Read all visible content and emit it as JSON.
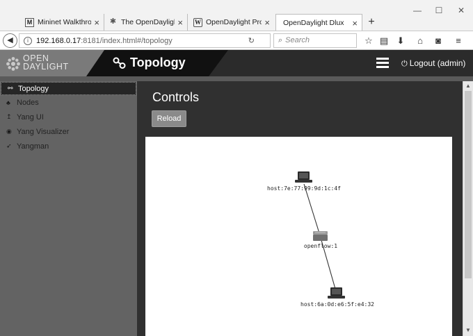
{
  "browser": {
    "tabs": [
      {
        "favicon": "M",
        "title": "Mininet Walkthroug",
        "close": "×"
      },
      {
        "favicon": "✱",
        "title": "The OpenDaylight P",
        "close": "×"
      },
      {
        "favicon": "W",
        "title": "OpenDaylight Proje",
        "close": "×"
      },
      {
        "favicon": "",
        "title": "OpenDaylight Dlux",
        "close": "×"
      }
    ],
    "new_tab": "+",
    "window_controls": {
      "minimize": "—",
      "maximize": "☐",
      "close": "✕"
    },
    "url_host": "192.168.0.17",
    "url_rest": ":8181/index.html#/topology",
    "search_placeholder": "Search",
    "toolbar_icons": [
      "star-icon",
      "reading-list-icon",
      "download-icon",
      "home-icon",
      "pocket-icon",
      "menu-icon"
    ]
  },
  "header": {
    "logo_line1": "OPEN",
    "logo_line2": "DAYLIGHT",
    "title": "Topology",
    "logout": "Logout (admin)"
  },
  "sidebar": {
    "items": [
      {
        "label": "Topology",
        "icon": "topology-icon",
        "active": true
      },
      {
        "label": "Nodes",
        "icon": "sitemap-icon",
        "active": false
      },
      {
        "label": "Yang UI",
        "icon": "yang-ui-icon",
        "active": false
      },
      {
        "label": "Yang Visualizer",
        "icon": "eye-icon",
        "active": false
      },
      {
        "label": "Yangman",
        "icon": "rocket-icon",
        "active": false
      }
    ]
  },
  "main": {
    "title": "Controls",
    "reload_label": "Reload",
    "topology": {
      "nodes": [
        {
          "id": "host1",
          "type": "host",
          "label": "host:7e:77:99:9d:1c:4f"
        },
        {
          "id": "switch1",
          "type": "switch",
          "label": "openflow:1"
        },
        {
          "id": "host2",
          "type": "host",
          "label": "host:6a:0d:e6:5f:e4:32"
        }
      ],
      "links": [
        {
          "from": "host1",
          "to": "switch1"
        },
        {
          "from": "switch1",
          "to": "host2"
        }
      ]
    }
  }
}
